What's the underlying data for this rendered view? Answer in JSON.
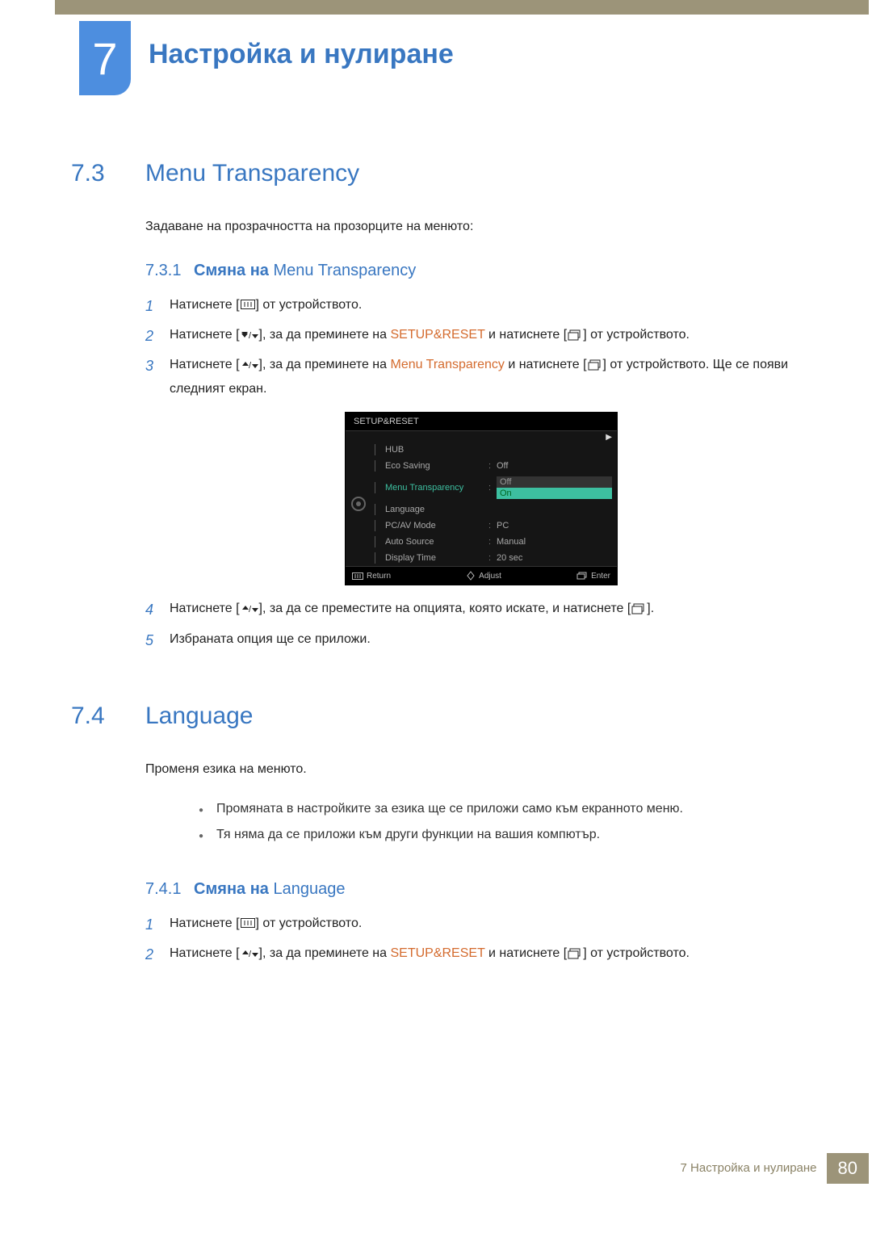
{
  "chapter": {
    "number": "7",
    "title": "Настройка и нулиране"
  },
  "section1": {
    "num": "7.3",
    "title": "Menu Transparency",
    "intro": "Задаване на прозрачността на прозорците на менюто:",
    "sub_num": "7.3.1",
    "sub_bold": "Смяна на ",
    "sub_reg": "Menu Transparency",
    "steps": {
      "s1_a": "Натиснете [",
      "s1_b": "] от устройството.",
      "s2_a": "Натиснете [",
      "s2_b": "], за да преминете на ",
      "s2_hl": "SETUP&RESET",
      "s2_c": " и натиснете [",
      "s2_d": "] от устройството.",
      "s3_a": "Натиснете [",
      "s3_b": "], за да преминете на ",
      "s3_hl": "Menu Transparency",
      "s3_c": " и натиснете [",
      "s3_d": "] от устройството. Ще се появи следният екран.",
      "s4_a": "Натиснете [",
      "s4_b": "], за да се преместите на опцията, която искате, и натиснете [",
      "s4_c": "].",
      "s5": "Избраната опция ще се приложи."
    }
  },
  "osd": {
    "title": "SETUP&RESET",
    "rows": [
      {
        "label": "HUB",
        "value": ""
      },
      {
        "label": "Eco Saving",
        "value": "Off"
      },
      {
        "label": "Menu Transparency",
        "value": "",
        "active": true,
        "dropdown": [
          "Off",
          "On"
        ]
      },
      {
        "label": "Language",
        "value": ""
      },
      {
        "label": "PC/AV Mode",
        "value": "PC"
      },
      {
        "label": "Auto Source",
        "value": "Manual"
      },
      {
        "label": "Display Time",
        "value": "20 sec"
      }
    ],
    "footer": {
      "return": "Return",
      "adjust": "Adjust",
      "enter": "Enter"
    }
  },
  "section2": {
    "num": "7.4",
    "title": "Language",
    "intro": "Променя езика на менюто.",
    "bullets": [
      "Промяната в настройките за езика ще се приложи само към екранното меню.",
      "Тя няма да се приложи към други функции на вашия компютър."
    ],
    "sub_num": "7.4.1",
    "sub_bold": "Смяна на ",
    "sub_reg": "Language",
    "steps": {
      "s1_a": "Натиснете [",
      "s1_b": "] от устройството.",
      "s2_a": "Натиснете [",
      "s2_b": "], за да преминете на ",
      "s2_hl": "SETUP&RESET",
      "s2_c": " и натиснете [",
      "s2_d": "] от устройството."
    }
  },
  "footer": {
    "text": "7 Настройка и нулиране",
    "page": "80"
  }
}
